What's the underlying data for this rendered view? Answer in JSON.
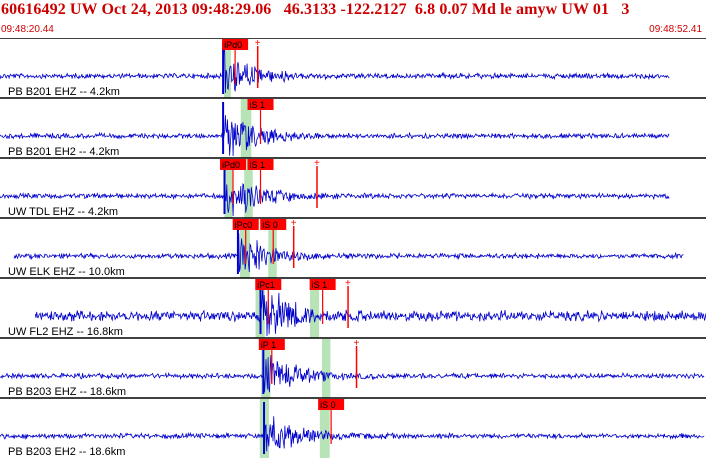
{
  "header": {
    "title": "60616492 UW Oct 24, 2013 09:48:29.06   46.3133 -122.2127  6.8 0.07 Md le amyw UW 01   3",
    "start_time": "09:48:20.44",
    "end_time": "09:48:52.41"
  },
  "colors": {
    "trace": "#0000cc",
    "pick": "#ff0000",
    "pick_text": "#000000",
    "window": "#b7e3b7",
    "separator": "#000000",
    "label": "#000000",
    "header_text": "#cc0000"
  },
  "traces": [
    {
      "label": "PB B201 EHZ -- 4.2km",
      "data_start": 0.0,
      "data_end": 0.948,
      "picks": [
        {
          "text": "iPd0",
          "t": 0.316
        }
      ],
      "window": [
        0.317,
        0.327
      ],
      "onset": 0.316,
      "amplitude": 28,
      "base_noise": 2,
      "coda_marker": 0.365
    },
    {
      "label": "PB B201 EH2 -- 4.2km",
      "data_start": 0.0,
      "data_end": 0.948,
      "picks": [
        {
          "text": "iS 1",
          "t": 0.352
        }
      ],
      "window": [
        0.341,
        0.356
      ],
      "onset": 0.316,
      "amplitude": 30,
      "base_noise": 2
    },
    {
      "label": "UW TDL EHZ -- 4.2km",
      "data_start": 0.0,
      "data_end": 0.948,
      "picks": [
        {
          "text": "iPd0",
          "t": 0.313
        },
        {
          "text": "iS 1",
          "t": 0.352
        }
      ],
      "window": [
        0.318,
        0.329
      ],
      "window2": [
        0.346,
        0.358
      ],
      "onset": 0.318,
      "amplitude": 30,
      "base_noise": 2,
      "coda_marker": 0.449
    },
    {
      "label": "UW ELK EHZ -- 10.0km",
      "data_start": 0.02,
      "data_end": 0.968,
      "picks": [
        {
          "text": "iPc0",
          "t": 0.331
        },
        {
          "text": "iS 0",
          "t": 0.37
        }
      ],
      "window": [
        0.34,
        0.354
      ],
      "window2": [
        0.38,
        0.392
      ],
      "onset": 0.337,
      "amplitude": 26,
      "base_noise": 2,
      "coda_marker": 0.416
    },
    {
      "label": "UW FL2 EHZ -- 16.8km",
      "data_start": 0.05,
      "data_end": 1.0,
      "picks": [
        {
          "text": "iPc1",
          "t": 0.363
        },
        {
          "text": "iS 1",
          "t": 0.44
        }
      ],
      "window": [
        0.362,
        0.375
      ],
      "window2": [
        0.439,
        0.452
      ],
      "onset": 0.369,
      "amplitude": 30,
      "base_noise": 4,
      "coda_marker": 0.493
    },
    {
      "label": "PB B203 EHZ -- 18.6km",
      "data_start": 0.0,
      "data_end": 0.998,
      "picks": [
        {
          "text": "iP 1",
          "t": 0.368
        }
      ],
      "window": [
        0.37,
        0.383
      ],
      "window2": [
        0.456,
        0.468
      ],
      "onset": 0.373,
      "amplitude": 26,
      "base_noise": 2,
      "coda_marker": 0.505
    },
    {
      "label": "PB B203 EH2 -- 18.6km",
      "data_start": 0.0,
      "data_end": 0.998,
      "picks": [
        {
          "text": "iS 0",
          "t": 0.452
        }
      ],
      "window": [
        0.368,
        0.381
      ],
      "window2": [
        0.453,
        0.467
      ],
      "onset": 0.374,
      "amplitude": 26,
      "base_noise": 2
    }
  ]
}
